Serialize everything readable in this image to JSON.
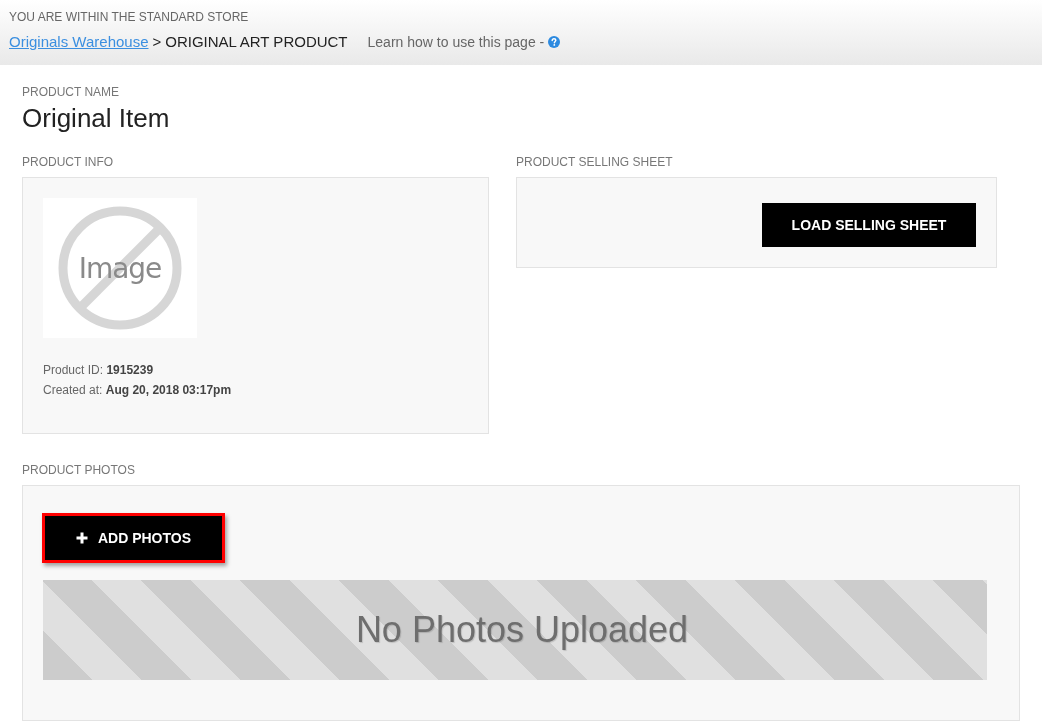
{
  "header": {
    "store_notice": "YOU ARE WITHIN THE STANDARD STORE",
    "breadcrumb": [
      {
        "label": "Originals Warehouse",
        "kind": "link"
      },
      {
        "label": "ORIGINAL ART PRODUCT",
        "kind": "current"
      }
    ],
    "separator": ">",
    "help_text": "Learn how to use this page -"
  },
  "product_name": {
    "label": "PRODUCT NAME",
    "value": "Original Item"
  },
  "product_info": {
    "label": "PRODUCT INFO",
    "image_placeholder": {
      "text": "Image"
    },
    "fields": [
      {
        "label": "Product ID:",
        "value": "1915239"
      },
      {
        "label": "Created at:",
        "value": "Aug 20, 2018 03:17pm"
      }
    ]
  },
  "selling_sheet": {
    "label": "PRODUCT SELLING SHEET",
    "button": "LOAD SELLING SHEET"
  },
  "photos": {
    "label": "PRODUCT PHOTOS",
    "add_button": {
      "label": "ADD PHOTOS",
      "highlighted": true
    },
    "empty_message": "No Photos Uploaded"
  }
}
